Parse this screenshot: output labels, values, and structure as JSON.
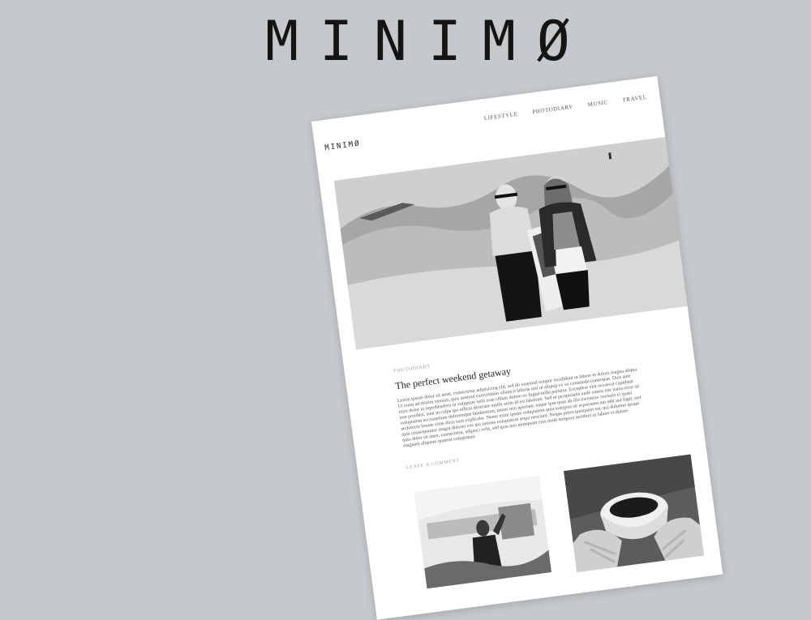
{
  "brand": {
    "title": "MINIMØ"
  },
  "site": {
    "logo": "MINIMØ",
    "nav": [
      {
        "label": "LIFESTYLE"
      },
      {
        "label": "PHOTODIARY"
      },
      {
        "label": "MUSIC"
      },
      {
        "label": "TRAVEL"
      }
    ]
  },
  "post": {
    "category": "PHOTODIARY",
    "title": "The perfect weekend getaway",
    "body_lines": [
      "Lorem ipsum dolor sit amet, consectetur adipisicing elit, sed do eiusmod tempor incididunt ut labore et dolore magna aliqua.",
      "Ut enim ad minim veniam, quis nostrud exercitation ullamco laboris nisi ut aliquip ex ea commodo consequat. Duis aute",
      "irure dolor in reprehenderit in voluptate velit esse cillum dolore eu fugiat nulla pariatur. Excepteur sint occaecat cupidatat",
      "non proident, sunt in culpa qui officia deserunt mollit anim id est laborum. Sed ut perspiciatis unde omnis iste natus error sit",
      "voluptatem accusantium doloremque laudantium, totam rem aperiam, eaque ipsa quae ab illo inventore veritatis et quasi",
      "architecto beatae vitae dicta sunt explicabo. Nemo enim ipsam voluptatem quia voluptas sit aspernatur aut odit aut fugit, sed",
      "quia consequuntur magni dolores eos qui ratione voluptatem sequi nesciunt. Neque porro quisquam est, qui dolorem ipsum",
      "quia dolor sit amet, consectetur, adipisci velit, sed quia non numquam eius modi tempora incidunt ut labore et dolore",
      "magnam aliquam quaerat voluptatem."
    ],
    "comment_link": "LEAVE A COMMENT"
  }
}
